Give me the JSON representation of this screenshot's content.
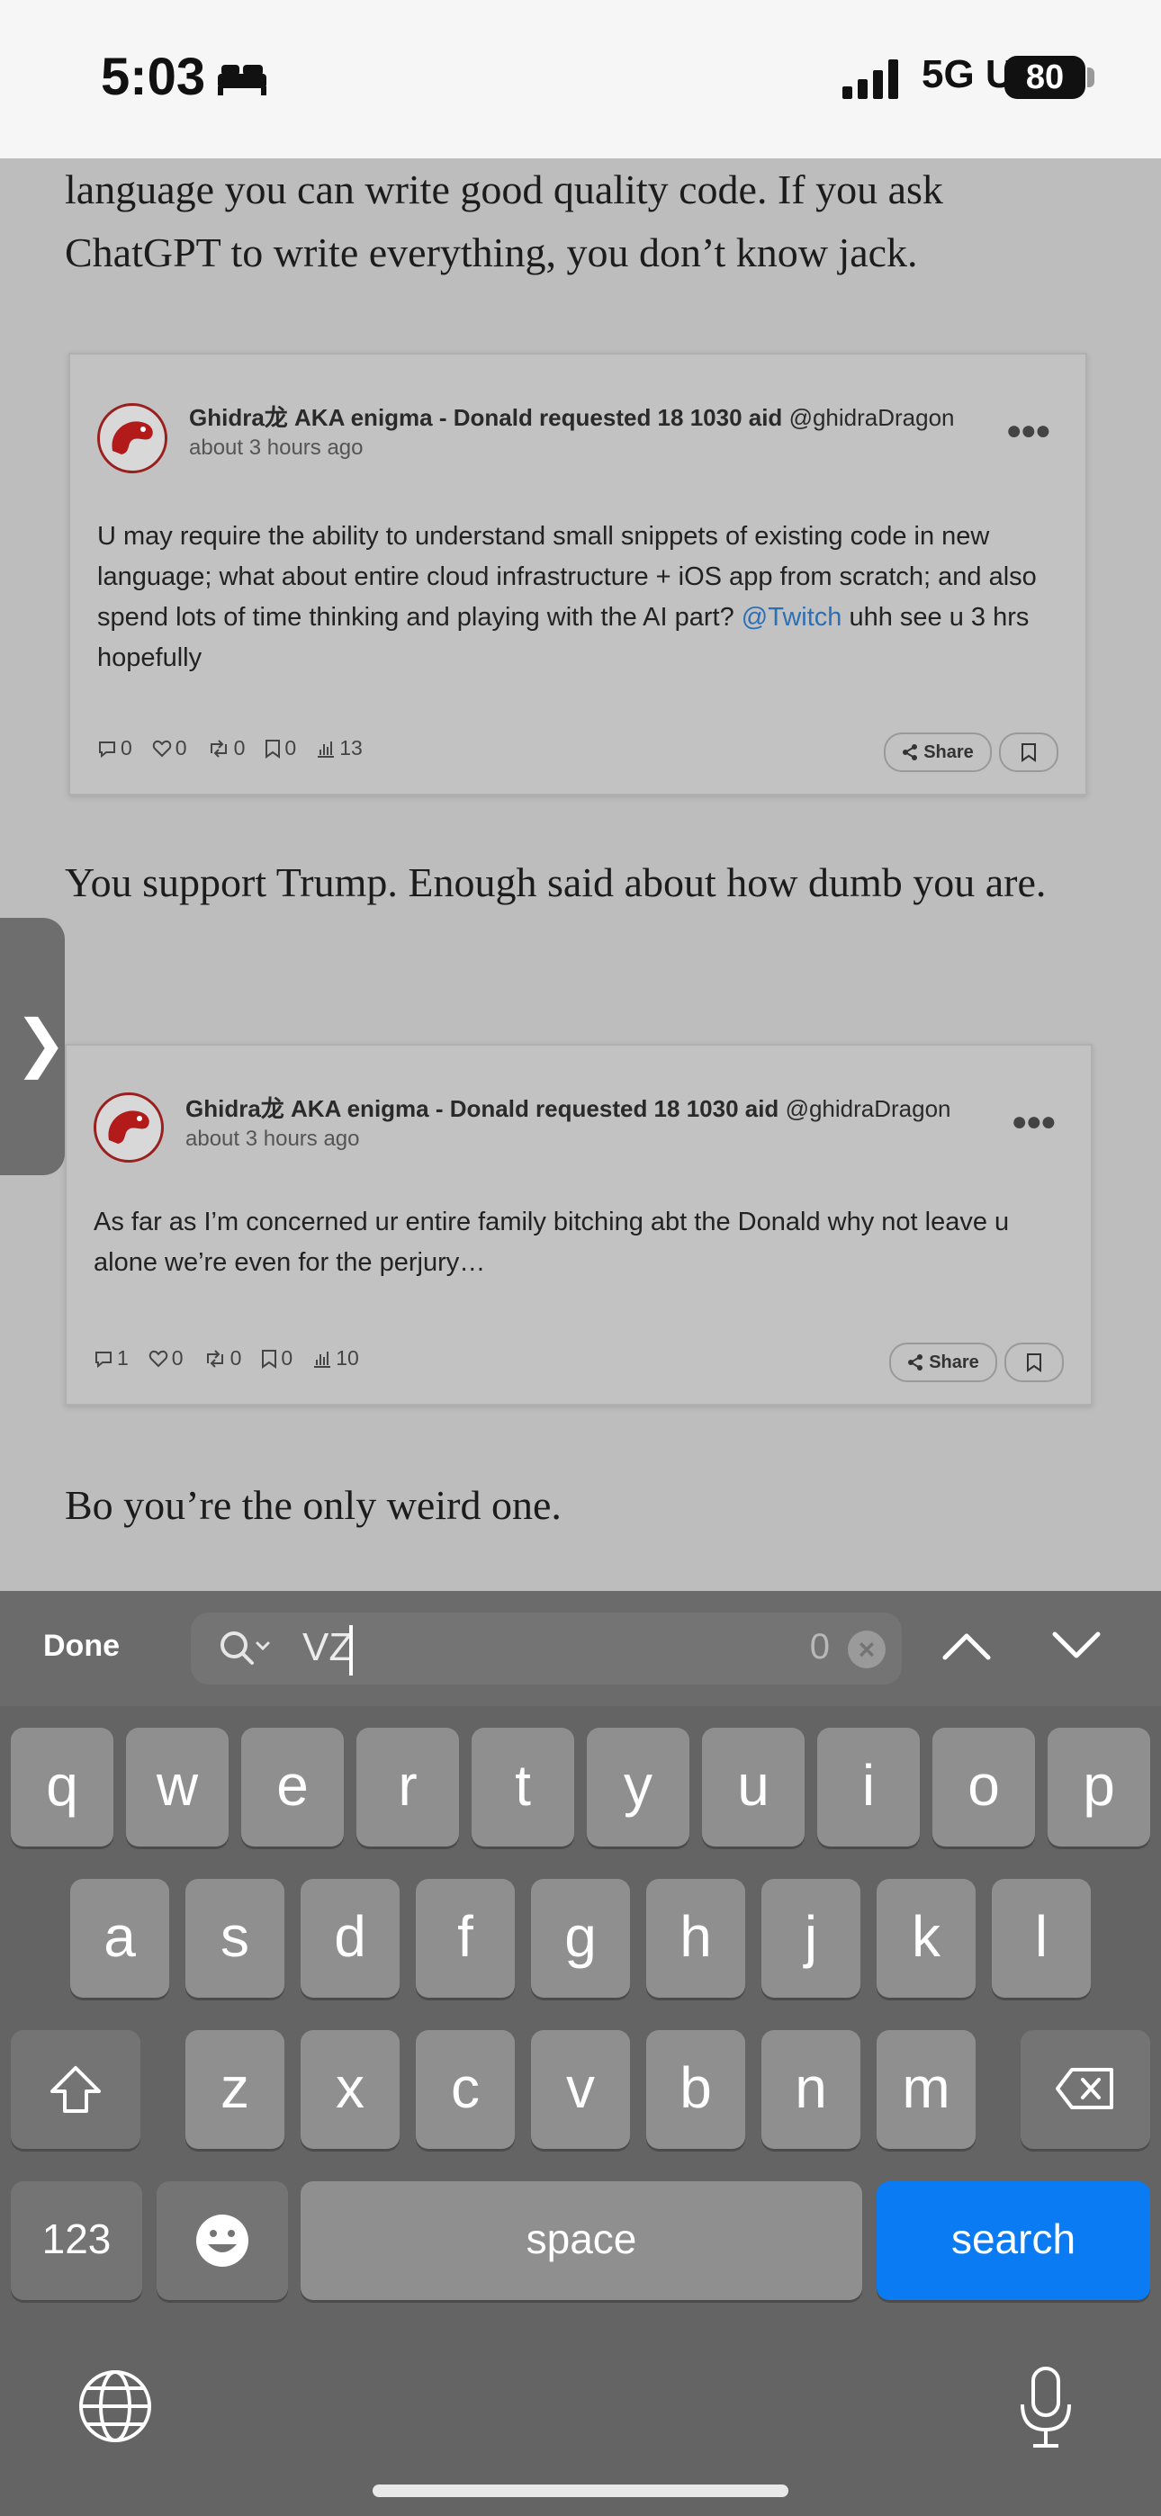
{
  "status_bar": {
    "time": "5:03",
    "network": "5G UW",
    "battery": "80"
  },
  "article": {
    "paragraph1": "language you can write good quality code. If you ask ChatGPT to write everything, you don’t know jack.",
    "paragraph2": "You support Trump. Enough said about how dumb you are.",
    "paragraph3": "Bo you’re the only weird one."
  },
  "tweets": [
    {
      "author": "Ghidra龙 AKA enigma - Donald requested 18 1030 aid",
      "handle": "@ghidraDragon",
      "time": "about 3 hours ago",
      "text": "U may require the ability to understand small snippets of existing code in new language; what about entire cloud infrastructure + iOS app from scratch; and also spend lots of time thinking and playing with the AI part?",
      "mention": "@Twitch",
      "text_after": "uhh see u 3 hrs hopefully",
      "replies": "0",
      "likes": "0",
      "retweets": "0",
      "bookmarks": "0",
      "views": "13",
      "share_label": "Share"
    },
    {
      "author": "Ghidra龙 AKA enigma - Donald requested 18 1030 aid",
      "handle": "@ghidraDragon",
      "time": "about 3 hours ago",
      "text": "As far as I’m concerned ur entire family bitching abt the Donald why not leave u alone we’re even for the perjury…",
      "replies": "1",
      "likes": "0",
      "retweets": "0",
      "bookmarks": "0",
      "views": "10",
      "share_label": "Share"
    }
  ],
  "side_tab": {
    "label": "❯"
  },
  "find_bar": {
    "done_label": "Done",
    "query": "VZ",
    "match_count": "0"
  },
  "keyboard": {
    "row1": [
      "q",
      "w",
      "e",
      "r",
      "t",
      "y",
      "u",
      "i",
      "o",
      "p"
    ],
    "row2": [
      "a",
      "s",
      "d",
      "f",
      "g",
      "h",
      "j",
      "k",
      "l"
    ],
    "row3": [
      "z",
      "x",
      "c",
      "v",
      "b",
      "n",
      "m"
    ],
    "numbers_label": "123",
    "space_label": "space",
    "search_label": "search"
  },
  "colors": {
    "accent": "#0a7bf2",
    "mention": "#2d6fb5"
  }
}
